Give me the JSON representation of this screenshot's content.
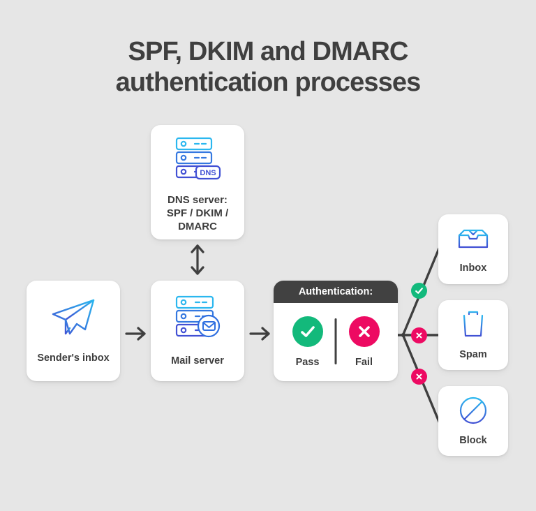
{
  "page": {
    "title": "SPF, DKIM and DMARC\nauthentication processes",
    "background_color": "#e6e6e6",
    "title_color": "#3f3f3f"
  },
  "colors": {
    "accent_blue_light": "#2bb7ef",
    "accent_blue_dark": "#4150d4",
    "pass_green": "#13b97b",
    "fail_pink": "#ed0a62",
    "dark": "#414141",
    "card_white": "#ffffff"
  },
  "nodes": {
    "dns": {
      "label": "DNS server:\nSPF / DKIM /\nDMARC",
      "icon": "dns-server-icon",
      "badge_text": "DNS"
    },
    "sender": {
      "label": "Sender's inbox",
      "icon": "paper-plane-icon"
    },
    "mail_server": {
      "label": "Mail server",
      "icon": "mail-server-icon"
    },
    "authentication": {
      "header": "Authentication:",
      "results": [
        {
          "label": "Pass",
          "icon": "check-circle-icon",
          "color": "#13b97b"
        },
        {
          "label": "Fail",
          "icon": "x-circle-icon",
          "color": "#ed0a62"
        }
      ]
    },
    "destinations": [
      {
        "label": "Inbox",
        "icon": "inbox-tray-icon"
      },
      {
        "label": "Spam",
        "icon": "trash-can-icon"
      },
      {
        "label": "Block",
        "icon": "block-circle-icon"
      }
    ]
  },
  "connectors": {
    "sender_to_mail": {
      "icon": "arrow-right-icon"
    },
    "mail_to_auth": {
      "icon": "arrow-right-icon"
    },
    "dns_to_mail": {
      "icon": "arrow-up-down-icon"
    },
    "branch_badges": [
      {
        "target": "Inbox",
        "icon": "check-circle-small-icon",
        "state": "pass",
        "color": "#12b97c"
      },
      {
        "target": "Spam",
        "icon": "x-circle-small-icon",
        "state": "fail",
        "color": "#ed0a62"
      },
      {
        "target": "Block",
        "icon": "x-circle-small-icon",
        "state": "fail",
        "color": "#ed0a62"
      }
    ]
  }
}
